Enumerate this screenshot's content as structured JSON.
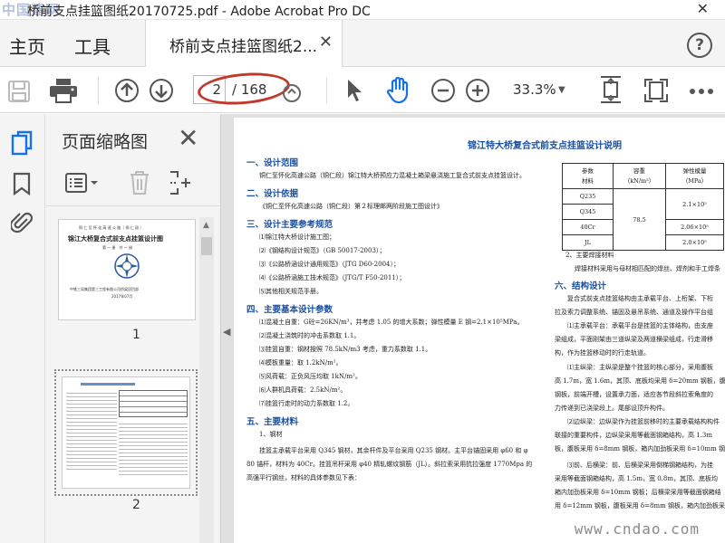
{
  "window": {
    "title": "桥前支点挂篮图纸20170725.pdf - Adobe Acrobat Pro DC",
    "watermark": "中国建网"
  },
  "menubar": {
    "home": "主页",
    "tools": "工具",
    "tab_label": "桥前支点挂篮图纸2...",
    "help": "?"
  },
  "toolbar": {
    "current_page": "2",
    "total_pages": "/ 168",
    "zoom": "33.3%"
  },
  "panel": {
    "title": "页面缩略图",
    "thumbnails": [
      {
        "number": "1",
        "line1": "铜 仁 至 怀 化 高 速 公 路（ 铜 仁 段 ）",
        "line2": "锦江大桥复合式前支点挂篮设计图",
        "line3": "第 一 册　共 一 册",
        "line4": "中铁三局集团第三工程有限公司桥梁项目部",
        "line5": "2017年07月"
      },
      {
        "number": "2"
      }
    ]
  },
  "document": {
    "title": "锦江特大桥复合式前支点挂篮设计说明",
    "sections": [
      {
        "heading": "一、设计范围",
        "lines": [
          "铜仁至怀化高速公路（铜仁段）锦江特大桥预应力混凝土箱梁悬浇施工复合式前支点挂篮设计。"
        ]
      },
      {
        "heading": "二、设计依据",
        "lines": [
          "《铜仁至怀化高速公路（铜仁段）第２标理邮两阶段施工图设计》"
        ]
      },
      {
        "heading": "三、设计主要参考规范",
        "lines": [
          "⑴锦江特大桥设计施工图；",
          "⑵《钢结构设计规范》（GB 50017-2003）；",
          "⑶《公路桥涵设计通用规范》（JTG D60-2004）；",
          "⑷《公路桥涵施工技术规范》（JTG/T F50-2011）；",
          "⑸其他相关规范手册。"
        ]
      },
      {
        "heading": "四、主要基本设计参数",
        "lines": [
          "⑴混凝土自重：G砼=26KN/m³，并考虑 1.05 的增大系数；弹性模量 E 钢=2.1×10⁵MPa。",
          "⑵混凝土浇筑时的冲击系数取 1.1。",
          "⑶挂篮自重：钢材按照 78.5kN/m3 考虑，重力系数取 1.1。",
          "⑷模板重量：取 1.2kN/m²。",
          "⑸风荷载：正负风压均取 1kN/m²。",
          "⑹人群机具荷载：2.5kN/m²。",
          "⑺挂篮行走时的动力系数取 1.2。"
        ]
      },
      {
        "heading": "五、主要材料",
        "lines": [
          "1、钢材",
          "挂篮主承载平台采用 Q345 钢材，其余杆件及平台采用 Q235 钢材。主平台锚固采用 φ60 和 φ",
          "80 锚杆，材料为 40Cr。挂篮吊杆采用 φ40 精轧螺纹钢筋（JL）。斜拉索采用抗拉强度 1770Mpa 的",
          "高强平行钢丝，材料的具体参数见下表："
        ]
      }
    ],
    "table": {
      "headers": [
        "参数",
        "容重",
        "弹性模量"
      ],
      "sub_headers": [
        "材料",
        "（kN/m³）",
        "（MPa）"
      ],
      "rows": [
        {
          "material": "Q235",
          "density": "",
          "modulus": "2.1×10⁵"
        },
        {
          "material": "Q345",
          "density": "78.5",
          "modulus": ""
        },
        {
          "material": "40Cr",
          "density": "",
          "modulus": "2.06×10⁵"
        },
        {
          "material": "JL",
          "density": "",
          "modulus": "2.0×10⁵"
        }
      ]
    },
    "right_column": [
      "2、主要焊接材料",
      "焊接材料采用与母材相匹配的焊丝、焊剂和手工焊条",
      "六、结构设计",
      "复合式前支点挂篮结构由主承载平台、上桁架、下桁",
      "拉及索力调整系统、锚固及悬吊系统、通道及操作平台组",
      "⑴主承载平台：承载平台是挂篮的主体结构，由支座",
      "梁组成，平面刚架由三道纵梁及两道横梁组成，行走滑移",
      "构，作为挂篮移动时的行走轨道。",
      "⑴主纵梁：主纵梁是整个挂篮的核心部分，采用腹板",
      "高 1.7m，宽 1.6m，其顶、底板均采用 δ=20mm 钢板，腹板采",
      "钢板，前端开槽，设置承力面，适应各节段斜拉索角度的",
      "力传递到已浇梁段上。尾部设顶升构件。",
      "⑵边纵梁：边纵梁作为挂篮前移时的主要承载结构构件",
      "联接的重要构件，边纵梁采用等截面钢箱结构，高 1.3m",
      "板，腹板采用 δ=8mm 钢板，箱内加劲板采用 δ=10mm 钢",
      "⑶前、后横梁：前、后横梁采用倒梯钢箱结构，为挂",
      "采用等截面钢箱结构，高 1.5m，宽 0.8m，其顶、底板均",
      "箱内加劲板采用 δ=10mm 钢板；后横梁采用等截面钢箱结",
      "用 δ=12mm 钢板，腹板采用 δ=8mm 钢板，箱内加劲板采用"
    ],
    "footer_watermark": "www.cndao.com"
  }
}
